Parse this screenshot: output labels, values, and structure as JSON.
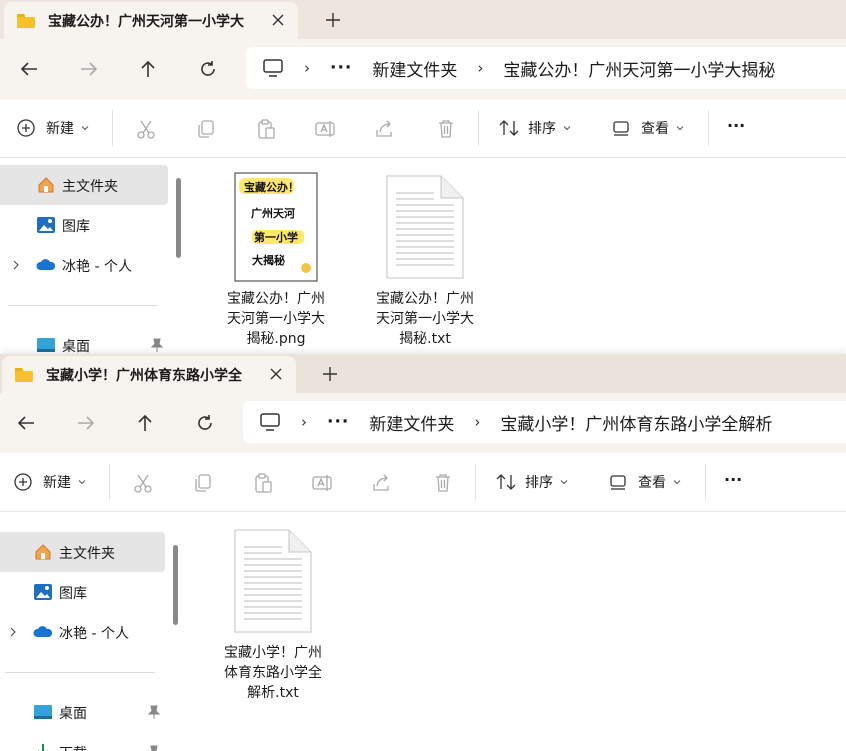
{
  "windows": [
    {
      "tab_title": "宝藏公办！广州天河第一小学大",
      "breadcrumb": {
        "dots": "···",
        "folder": "新建文件夹",
        "current": "宝藏公办！广州天河第一小学大揭秘"
      },
      "toolbar": {
        "new_label": "新建",
        "sort_label": "排序",
        "view_label": "查看",
        "more_label": "···"
      },
      "sidebar": [
        {
          "label": "主文件夹",
          "icon": "home-icon",
          "selected": true
        },
        {
          "label": "图库",
          "icon": "gallery-icon"
        },
        {
          "label": "冰艳 - 个人",
          "icon": "onedrive-cloud-icon",
          "expandable": true
        },
        {
          "label": "桌面",
          "icon": "desktop-icon",
          "pinned": true
        }
      ],
      "files": [
        {
          "name": "宝藏公办！广州天河第一小学大揭秘.png",
          "name_lines": [
            "宝藏公办！广州",
            "天河第一小学大",
            "揭秘.png"
          ],
          "thumb_lines": [
            "宝藏公办！",
            "广州天河",
            "第一小学",
            "大揭秘"
          ]
        },
        {
          "name": "宝藏公办！广州天河第一小学大揭秘.txt",
          "name_lines": [
            "宝藏公办！广州",
            "天河第一小学大",
            "揭秘.txt"
          ]
        }
      ]
    },
    {
      "tab_title": "宝藏小学！广州体育东路小学全",
      "breadcrumb": {
        "dots": "···",
        "folder": "新建文件夹",
        "current": "宝藏小学！广州体育东路小学全解析"
      },
      "toolbar": {
        "new_label": "新建",
        "sort_label": "排序",
        "view_label": "查看",
        "more_label": "···"
      },
      "sidebar": [
        {
          "label": "主文件夹",
          "icon": "home-icon",
          "selected": true
        },
        {
          "label": "图库",
          "icon": "gallery-icon"
        },
        {
          "label": "冰艳 - 个人",
          "icon": "onedrive-cloud-icon",
          "expandable": true
        },
        {
          "label": "桌面",
          "icon": "desktop-icon",
          "pinned": true
        },
        {
          "label": "下载",
          "icon": "download-icon",
          "pinned": true
        }
      ],
      "files": [
        {
          "name": "宝藏小学！广州体育东路小学全解析.txt",
          "name_lines": [
            "宝藏小学！广州",
            "体育东路小学全",
            "解析.txt"
          ]
        }
      ]
    }
  ],
  "colors": {
    "folder": "#f6c12a",
    "tabstrip": "#ede5de",
    "selected": "#e5e5e5",
    "accent": "#0067c0"
  }
}
